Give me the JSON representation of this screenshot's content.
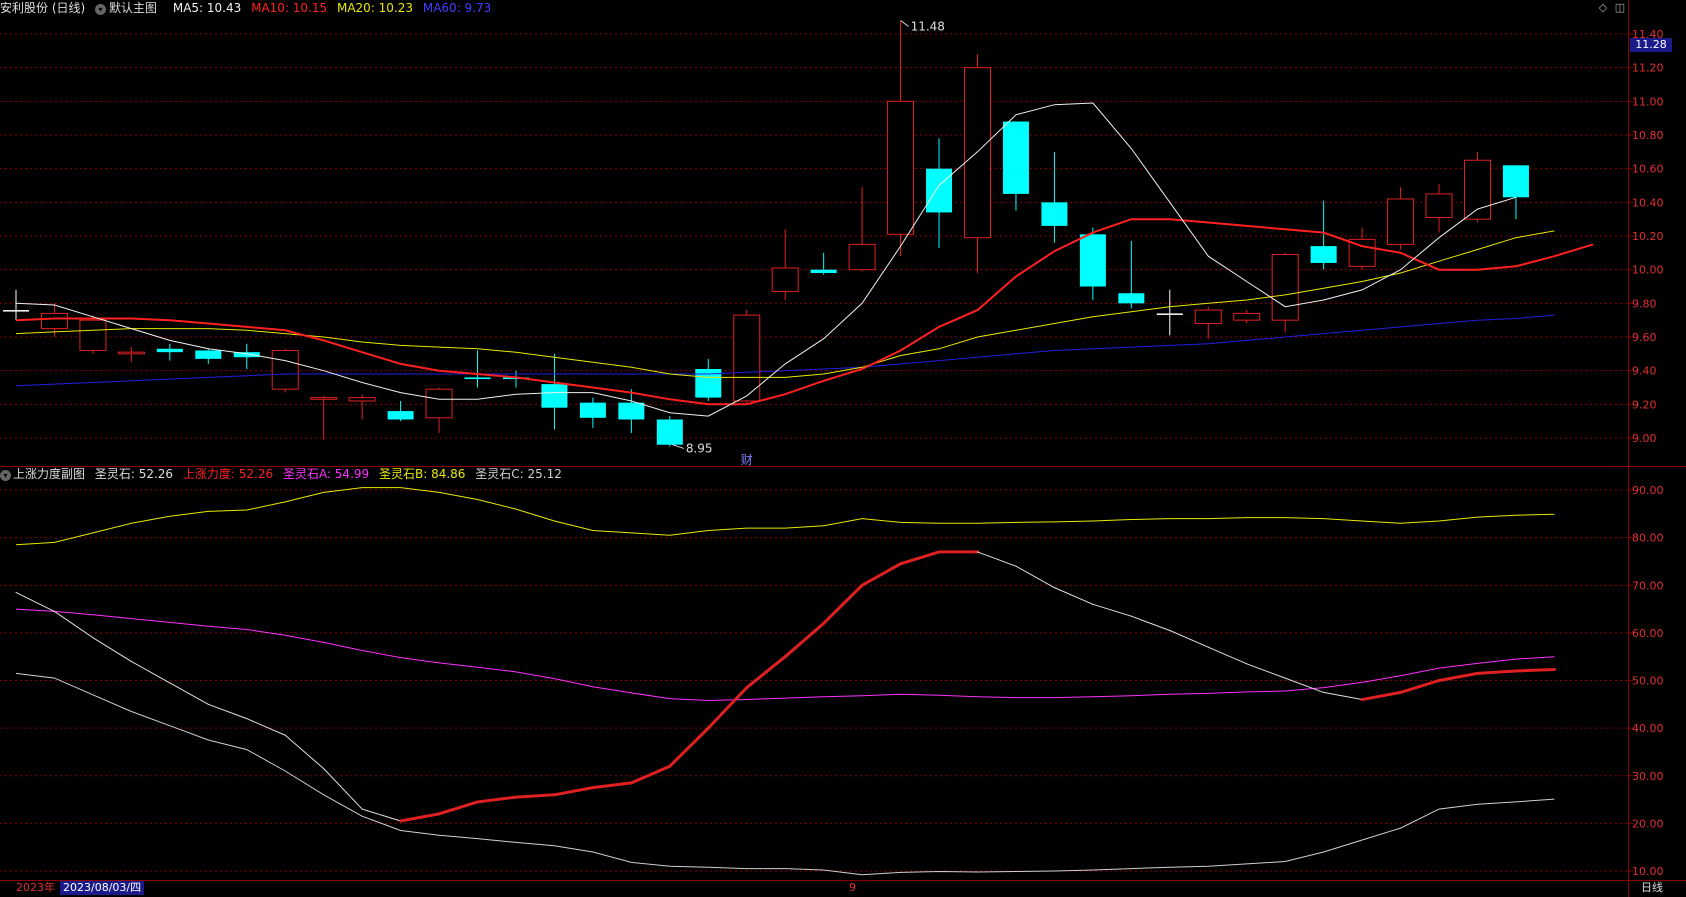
{
  "top_header": {
    "stock": "安利股份 (日线)",
    "main_view": "默认主图",
    "ma5": "MA5: 10.43",
    "ma10": "MA10: 10.15",
    "ma20": "MA20: 10.23",
    "ma60": "MA60: 9.73"
  },
  "sub_header": {
    "name": "上涨力度副图",
    "sl": "圣灵石: 52.26",
    "sp": "上涨力度: 52.26",
    "a": "圣灵石A: 54.99",
    "b": "圣灵石B: 84.86",
    "c": "圣灵石C: 25.12"
  },
  "price_box": "11.28",
  "annotations": {
    "high": "11.48",
    "low": "8.95",
    "cai": "财"
  },
  "footer": {
    "year": "2023年",
    "date": "2023/08/03/四",
    "month": "9",
    "period": "日线"
  },
  "colors": {
    "up": "#e02020",
    "down": "#00ffff",
    "ma5": "#f0f0f0",
    "ma10": "#ff2020",
    "ma20": "#e8e800",
    "ma60": "#2020e0",
    "a": "#ff30ff",
    "b": "#e8e800",
    "c": "#d0d0d0",
    "grid": "#8b0000"
  },
  "chart_data": [
    {
      "type": "candlestick",
      "ylim": [
        8.85,
        11.5
      ],
      "yticks": [
        "11.40",
        "11.20",
        "11.00",
        "10.80",
        "10.60",
        "10.40",
        "10.20",
        "10.00",
        "9.80",
        "9.60",
        "9.40",
        "9.20",
        "9.00"
      ],
      "candles": [
        {
          "o": 9.76,
          "c": 9.76,
          "h": 9.88,
          "l": 9.7
        },
        {
          "o": 9.65,
          "c": 9.74,
          "h": 9.8,
          "l": 9.6
        },
        {
          "o": 9.52,
          "c": 9.7,
          "h": 9.73,
          "l": 9.5
        },
        {
          "o": 9.5,
          "c": 9.51,
          "h": 9.54,
          "l": 9.45
        },
        {
          "o": 9.53,
          "c": 9.51,
          "h": 9.56,
          "l": 9.46
        },
        {
          "o": 9.52,
          "c": 9.47,
          "h": 9.53,
          "l": 9.44
        },
        {
          "o": 9.51,
          "c": 9.48,
          "h": 9.56,
          "l": 9.41
        },
        {
          "o": 9.29,
          "c": 9.52,
          "h": 9.53,
          "l": 9.27
        },
        {
          "o": 9.23,
          "c": 9.24,
          "h": 9.25,
          "l": 8.99
        },
        {
          "o": 9.22,
          "c": 9.24,
          "h": 9.26,
          "l": 9.11
        },
        {
          "o": 9.16,
          "c": 9.11,
          "h": 9.22,
          "l": 9.1
        },
        {
          "o": 9.12,
          "c": 9.29,
          "h": 9.3,
          "l": 9.03
        },
        {
          "o": 9.36,
          "c": 9.35,
          "h": 9.52,
          "l": 9.3
        },
        {
          "o": 9.36,
          "c": 9.35,
          "h": 9.4,
          "l": 9.3
        },
        {
          "o": 9.32,
          "c": 9.18,
          "h": 9.5,
          "l": 9.05
        },
        {
          "o": 9.21,
          "c": 9.12,
          "h": 9.24,
          "l": 9.06
        },
        {
          "o": 9.21,
          "c": 9.11,
          "h": 9.29,
          "l": 9.03
        },
        {
          "o": 9.11,
          "c": 8.96,
          "h": 9.13,
          "l": 8.95
        },
        {
          "o": 9.41,
          "c": 9.24,
          "h": 9.47,
          "l": 9.22
        },
        {
          "o": 9.22,
          "c": 9.73,
          "h": 9.76,
          "l": 9.2
        },
        {
          "o": 9.87,
          "c": 10.01,
          "h": 10.24,
          "l": 9.82
        },
        {
          "o": 10.0,
          "c": 9.98,
          "h": 10.1,
          "l": 9.97
        },
        {
          "o": 10.0,
          "c": 10.15,
          "h": 10.49,
          "l": 9.99
        },
        {
          "o": 10.21,
          "c": 11.0,
          "h": 11.48,
          "l": 10.08
        },
        {
          "o": 10.6,
          "c": 10.34,
          "h": 10.78,
          "l": 10.13
        },
        {
          "o": 10.19,
          "c": 11.2,
          "h": 11.28,
          "l": 9.98
        },
        {
          "o": 10.88,
          "c": 10.45,
          "h": 10.88,
          "l": 10.35
        },
        {
          "o": 10.4,
          "c": 10.26,
          "h": 10.7,
          "l": 10.16
        },
        {
          "o": 10.21,
          "c": 9.9,
          "h": 10.25,
          "l": 9.82
        },
        {
          "o": 9.86,
          "c": 9.8,
          "h": 10.17,
          "l": 9.77
        },
        {
          "o": 9.74,
          "c": 9.74,
          "h": 9.88,
          "l": 9.61
        },
        {
          "o": 9.68,
          "c": 9.76,
          "h": 9.78,
          "l": 9.59
        },
        {
          "o": 9.7,
          "c": 9.74,
          "h": 9.76,
          "l": 9.68
        },
        {
          "o": 9.7,
          "c": 10.09,
          "h": 10.1,
          "l": 9.63
        },
        {
          "o": 10.14,
          "c": 10.04,
          "h": 10.41,
          "l": 10.0
        },
        {
          "o": 10.02,
          "c": 10.18,
          "h": 10.25,
          "l": 10.0
        },
        {
          "o": 10.15,
          "c": 10.42,
          "h": 10.49,
          "l": 10.12
        },
        {
          "o": 10.31,
          "c": 10.45,
          "h": 10.51,
          "l": 10.22
        },
        {
          "o": 10.3,
          "c": 10.65,
          "h": 10.7,
          "l": 10.28
        },
        {
          "o": 10.62,
          "c": 10.43,
          "h": 10.62,
          "l": 10.3
        }
      ],
      "ma5": [
        9.8,
        9.79,
        9.72,
        9.65,
        9.58,
        9.53,
        9.5,
        9.46,
        9.4,
        9.33,
        9.27,
        9.23,
        9.23,
        9.26,
        9.27,
        9.27,
        9.22,
        9.15,
        9.13,
        9.25,
        9.44,
        9.59,
        9.8,
        10.14,
        10.5,
        10.7,
        10.92,
        10.98,
        10.99,
        10.72,
        10.4,
        10.08,
        9.93,
        9.78,
        9.82,
        9.88,
        10.0,
        10.19,
        10.36,
        10.43
      ],
      "ma10": [
        9.7,
        9.71,
        9.71,
        9.71,
        9.7,
        9.68,
        9.66,
        9.64,
        9.58,
        9.51,
        9.44,
        9.4,
        9.38,
        9.36,
        9.33,
        9.3,
        9.27,
        9.23,
        9.2,
        9.2,
        9.26,
        9.34,
        9.41,
        9.52,
        9.66,
        9.76,
        9.96,
        10.11,
        10.22,
        10.3,
        10.3,
        10.28,
        10.26,
        10.24,
        10.22,
        10.14,
        10.1,
        10.0,
        10.0,
        10.02,
        10.08,
        10.15
      ],
      "ma20": [
        9.62,
        9.63,
        9.64,
        9.65,
        9.65,
        9.65,
        9.64,
        9.62,
        9.6,
        9.57,
        9.55,
        9.54,
        9.53,
        9.51,
        9.48,
        9.45,
        9.42,
        9.38,
        9.36,
        9.36,
        9.36,
        9.38,
        9.42,
        9.49,
        9.53,
        9.6,
        9.64,
        9.68,
        9.72,
        9.75,
        9.78,
        9.8,
        9.82,
        9.85,
        9.89,
        9.93,
        9.98,
        10.05,
        10.12,
        10.19,
        10.23
      ],
      "ma60": [
        9.31,
        9.32,
        9.33,
        9.34,
        9.35,
        9.36,
        9.37,
        9.38,
        9.38,
        9.38,
        9.38,
        9.38,
        9.38,
        9.38,
        9.38,
        9.38,
        9.38,
        9.38,
        9.38,
        9.39,
        9.4,
        9.41,
        9.42,
        9.44,
        9.46,
        9.48,
        9.5,
        9.52,
        9.53,
        9.54,
        9.55,
        9.56,
        9.58,
        9.6,
        9.62,
        9.64,
        9.66,
        9.68,
        9.7,
        9.71,
        9.73
      ]
    },
    {
      "type": "line",
      "ylim": [
        8,
        94
      ],
      "yticks": [
        "90.00",
        "80.00",
        "70.00",
        "60.00",
        "50.00",
        "40.00",
        "30.00",
        "20.00",
        "10.00"
      ],
      "series": [
        {
          "name": "圣灵石A",
          "values": [
            65.0,
            64.5,
            63.8,
            63.0,
            62.2,
            61.4,
            60.7,
            59.5,
            58.0,
            56.3,
            54.8,
            53.7,
            52.8,
            51.8,
            50.4,
            48.7,
            47.4,
            46.2,
            45.8,
            46.0,
            46.3,
            46.6,
            46.8,
            47.1,
            46.9,
            46.6,
            46.4,
            46.4,
            46.6,
            46.8,
            47.1,
            47.3,
            47.6,
            47.8,
            48.5,
            49.6,
            51.0,
            52.6,
            53.6,
            54.5,
            55.0
          ]
        },
        {
          "name": "圣灵石B",
          "values": [
            78.5,
            79.0,
            81.0,
            83.0,
            84.5,
            85.5,
            85.8,
            87.5,
            89.5,
            90.5,
            90.5,
            89.5,
            88.0,
            86.0,
            83.5,
            81.5,
            81.0,
            80.5,
            81.5,
            82.0,
            82.0,
            82.5,
            84.0,
            83.2,
            83.0,
            83.0,
            83.2,
            83.3,
            83.5,
            83.8,
            84.0,
            84.0,
            84.2,
            84.2,
            84.0,
            83.5,
            83.0,
            83.5,
            84.3,
            84.7,
            84.9
          ]
        },
        {
          "name": "圣灵石C",
          "values": [
            51.5,
            50.5,
            47.0,
            43.5,
            40.5,
            37.5,
            35.5,
            31.0,
            26.0,
            21.5,
            18.5,
            17.5,
            16.8,
            16.0,
            15.3,
            14.0,
            11.8,
            11.0,
            10.8,
            10.5,
            10.5,
            10.2,
            9.2,
            9.7,
            9.9,
            9.8,
            9.9,
            10.0,
            10.2,
            10.5,
            10.8,
            11.0,
            11.5,
            12.0,
            14.0,
            16.5,
            19.0,
            23.0,
            24.0,
            24.5,
            25.1
          ]
        },
        {
          "name": "上涨力度",
          "values": [
            68.5,
            64.5,
            59.0,
            54.0,
            49.5,
            45.0,
            42.0,
            38.5,
            31.5,
            23.0,
            20.5,
            22.0,
            24.5,
            25.5,
            26.0,
            27.5,
            28.5,
            32.0,
            40.0,
            48.5,
            55.0,
            62.0,
            70.0,
            74.5,
            77.0,
            77.0,
            74.0,
            69.5,
            66.0,
            63.5,
            60.5,
            57.0,
            53.5,
            50.5,
            47.5,
            46.0,
            47.5,
            50.0,
            51.5,
            52.0,
            52.3
          ]
        }
      ]
    }
  ]
}
